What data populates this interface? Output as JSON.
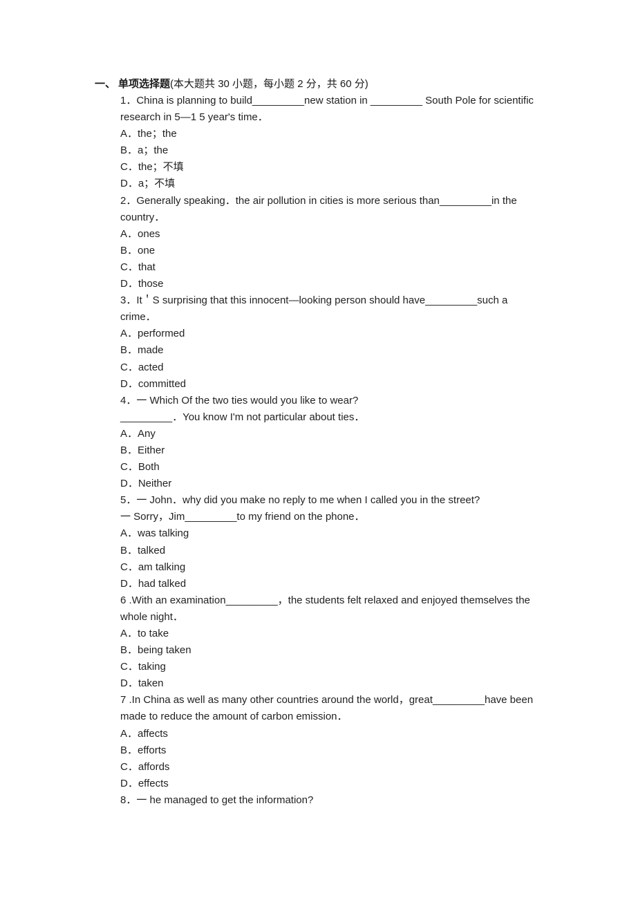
{
  "section": {
    "number": "一、",
    "title": "单项选择题",
    "note": "(本大题共 30 小题，每小题 2 分，共 60 分)"
  },
  "questions": [
    {
      "stem_lines": [
        "1．China is planning to build_________new station in _________ South Pole for scientific",
        "research in 5—1 5 year's time．"
      ],
      "options": [
        "A．the；the",
        "B．a；the",
        "C．the；不填",
        "D．a；不填"
      ]
    },
    {
      "stem_lines": [
        "2．Generally speaking．the air pollution in cities is more serious than_________in the",
        "country．"
      ],
      "options": [
        "A．ones",
        "B．one",
        "C．that",
        "D．those"
      ]
    },
    {
      "stem_lines": [
        "3．It＇S surprising that this innocent—looking person should have_________such a",
        "crime．"
      ],
      "options": [
        "A．performed",
        "B．made",
        "C．acted",
        "D．committed"
      ]
    },
    {
      "stem_lines": [
        "4．一 Which Of the two ties would you like to wear?",
        "_________．You know I'm not particular about ties．"
      ],
      "options": [
        "A．Any",
        "B．Either",
        "C．Both",
        "D．Neither"
      ]
    },
    {
      "stem_lines": [
        "5．一 John．why did you make no reply to me when I called you in the street?",
        "一 Sorry，Jim_________to my friend on the phone．"
      ],
      "options": [
        "A．was talking",
        "B．talked",
        "C．am talking",
        "D．had talked"
      ]
    },
    {
      "stem_lines": [
        "6 .With an examination_________，the students felt relaxed and enjoyed themselves the",
        "whole night．"
      ],
      "options": [
        "A．to take",
        "B．being taken",
        "C．taking",
        "D．taken"
      ]
    },
    {
      "stem_lines": [
        "7 .In China as well as many other countries around the world，great_________have been",
        "made to reduce the amount of carbon emission．"
      ],
      "options": [
        "A．affects",
        "B．efforts",
        "C．affords",
        "D．effects"
      ]
    },
    {
      "stem_lines": [
        "8．一 he managed to get the information?"
      ],
      "options": []
    }
  ]
}
